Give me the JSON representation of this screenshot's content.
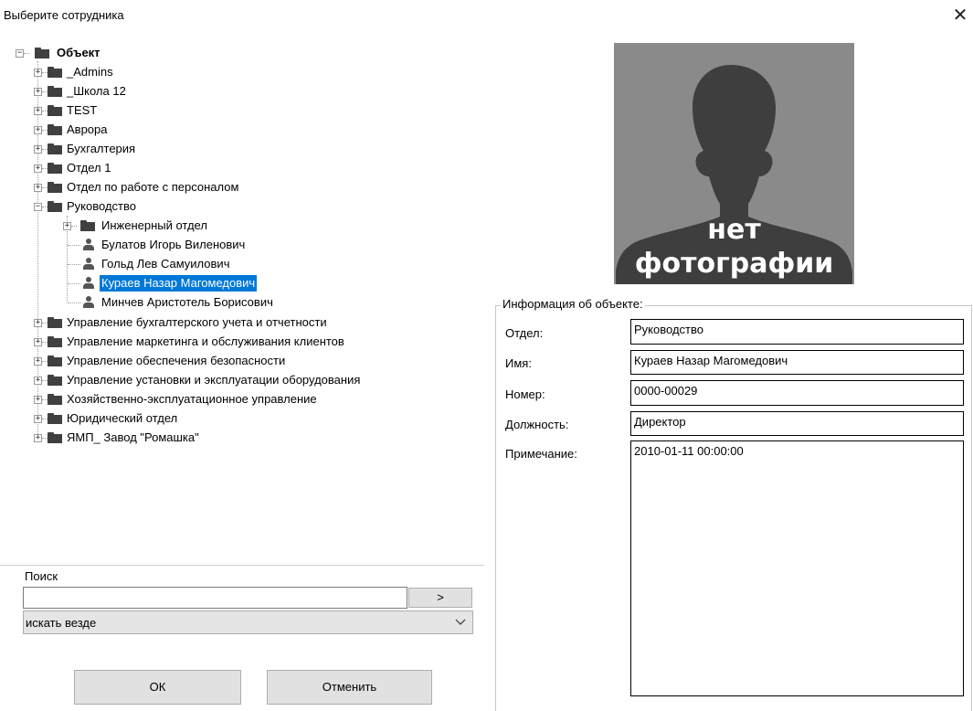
{
  "window": {
    "title": "Выберите сотрудника",
    "close_glyph": "✕"
  },
  "tree": {
    "root": "Объект",
    "items": [
      {
        "label": "_Admins"
      },
      {
        "label": "_Школа 12"
      },
      {
        "label": "TEST"
      },
      {
        "label": "Аврора"
      },
      {
        "label": "Бухгалтерия"
      },
      {
        "label": "Отдел 1"
      },
      {
        "label": "Отдел по работе с персоналом"
      },
      {
        "label": "Руководство"
      },
      {
        "label": "Инженерный отдел"
      },
      {
        "label": "Булатов Игорь Виленович"
      },
      {
        "label": "Гольд Лев Самуилович"
      },
      {
        "label": "Кураев Назар Магомедович"
      },
      {
        "label": "Минчев Аристотель Борисович"
      },
      {
        "label": "Управление бухгалтерского учета и отчетности"
      },
      {
        "label": "Управление маркетинга и обслуживания клиентов"
      },
      {
        "label": "Управление обеспечения безопасности"
      },
      {
        "label": "Управление установки и эксплуатации оборудования"
      },
      {
        "label": "Хозяйственно-эксплуатационное управление"
      },
      {
        "label": "Юридический отдел"
      },
      {
        "label": "ЯМП_ Завод \"Ромашка\""
      }
    ],
    "selected": "Кураев Назар Магомедович"
  },
  "photo": {
    "line1": "нет",
    "line2": "фотографии"
  },
  "info": {
    "legend": "Информация об объекте:",
    "dept_label": "Отдел:",
    "dept_value": "Руководство",
    "name_label": "Имя:",
    "name_value": "Кураев Назар Магомедович",
    "number_label": "Номер:",
    "number_value": "0000-00029",
    "position_label": "Должность:",
    "position_value": "Директор",
    "note_label": "Примечание:",
    "note_value": "2010-01-11 00:00:00"
  },
  "search": {
    "label": "Поиск",
    "value": "",
    "go_label": ">",
    "scope_value": "искать везде"
  },
  "buttons": {
    "ok": "ОК",
    "cancel": "Отменить"
  }
}
